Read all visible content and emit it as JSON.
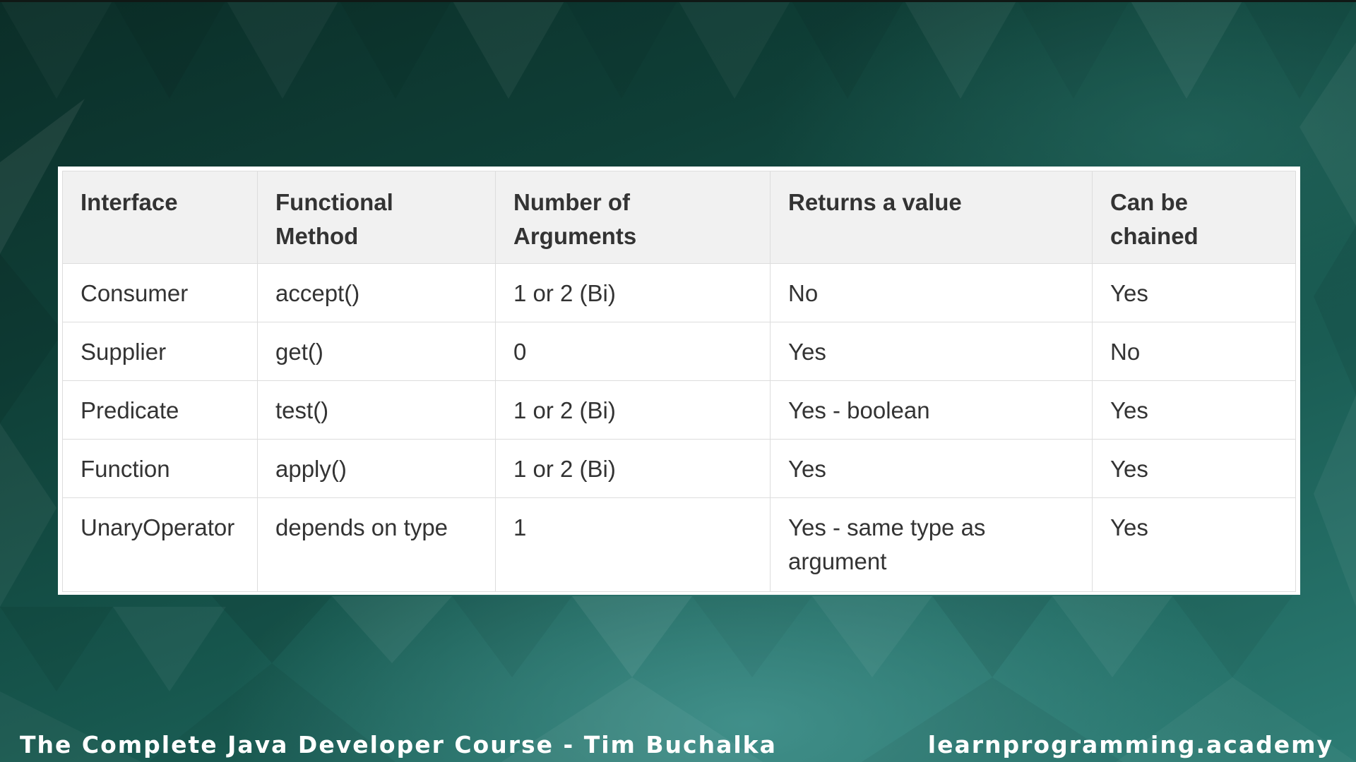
{
  "table": {
    "headers": [
      "Interface",
      "Functional Method",
      "Number of Arguments",
      "Returns a value",
      "Can be chained"
    ],
    "rows": [
      [
        "Consumer",
        "accept()",
        "1 or 2 (Bi)",
        "No",
        "Yes"
      ],
      [
        "Supplier",
        "get()",
        "0",
        "Yes",
        "No"
      ],
      [
        "Predicate",
        "test()",
        "1 or 2 (Bi)",
        "Yes - boolean",
        "Yes"
      ],
      [
        "Function",
        "apply()",
        "1 or 2 (Bi)",
        "Yes",
        "Yes"
      ],
      [
        "UnaryOperator",
        "depends on type",
        "1",
        "Yes - same type as argument",
        "Yes"
      ]
    ]
  },
  "footer": {
    "course_title": "The Complete Java Developer Course - Tim Buchalka",
    "website": "learnprogramming.academy"
  },
  "colors": {
    "background_dark": "#0b2e28",
    "background_light": "#2c7c74",
    "header_row": "#f1f1f1",
    "border": "#dddddd",
    "text": "#333333"
  }
}
